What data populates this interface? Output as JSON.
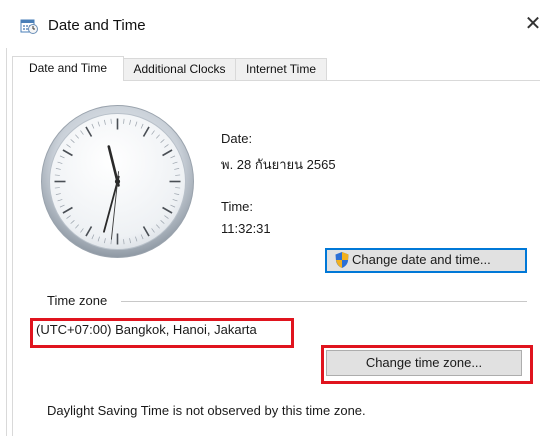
{
  "window": {
    "title": "Date and Time",
    "close_glyph": "✕"
  },
  "tabs": [
    {
      "label": "Date and Time",
      "active": true
    },
    {
      "label": "Additional Clocks",
      "active": false
    },
    {
      "label": "Internet Time",
      "active": false
    }
  ],
  "datetime": {
    "date_label": "Date:",
    "date_value": "พ. 28 กันยายน 2565",
    "time_label": "Time:",
    "time_value": "11:32:31",
    "change_button": "Change date and time..."
  },
  "clock": {
    "hours": 11,
    "minutes": 32,
    "seconds": 31
  },
  "timezone": {
    "group_label": "Time zone",
    "value": "(UTC+07:00) Bangkok, Hanoi, Jakarta",
    "change_button": "Change time zone..."
  },
  "dst_note": "Daylight Saving Time is not observed by this time zone.",
  "icons": {
    "title": "calendar-clock-icon",
    "shield": "uac-shield-icon",
    "close": "close-icon"
  },
  "colors": {
    "highlight": "#e0141e",
    "focus_border": "#0078d7",
    "button_bg": "#e1e1e1"
  }
}
